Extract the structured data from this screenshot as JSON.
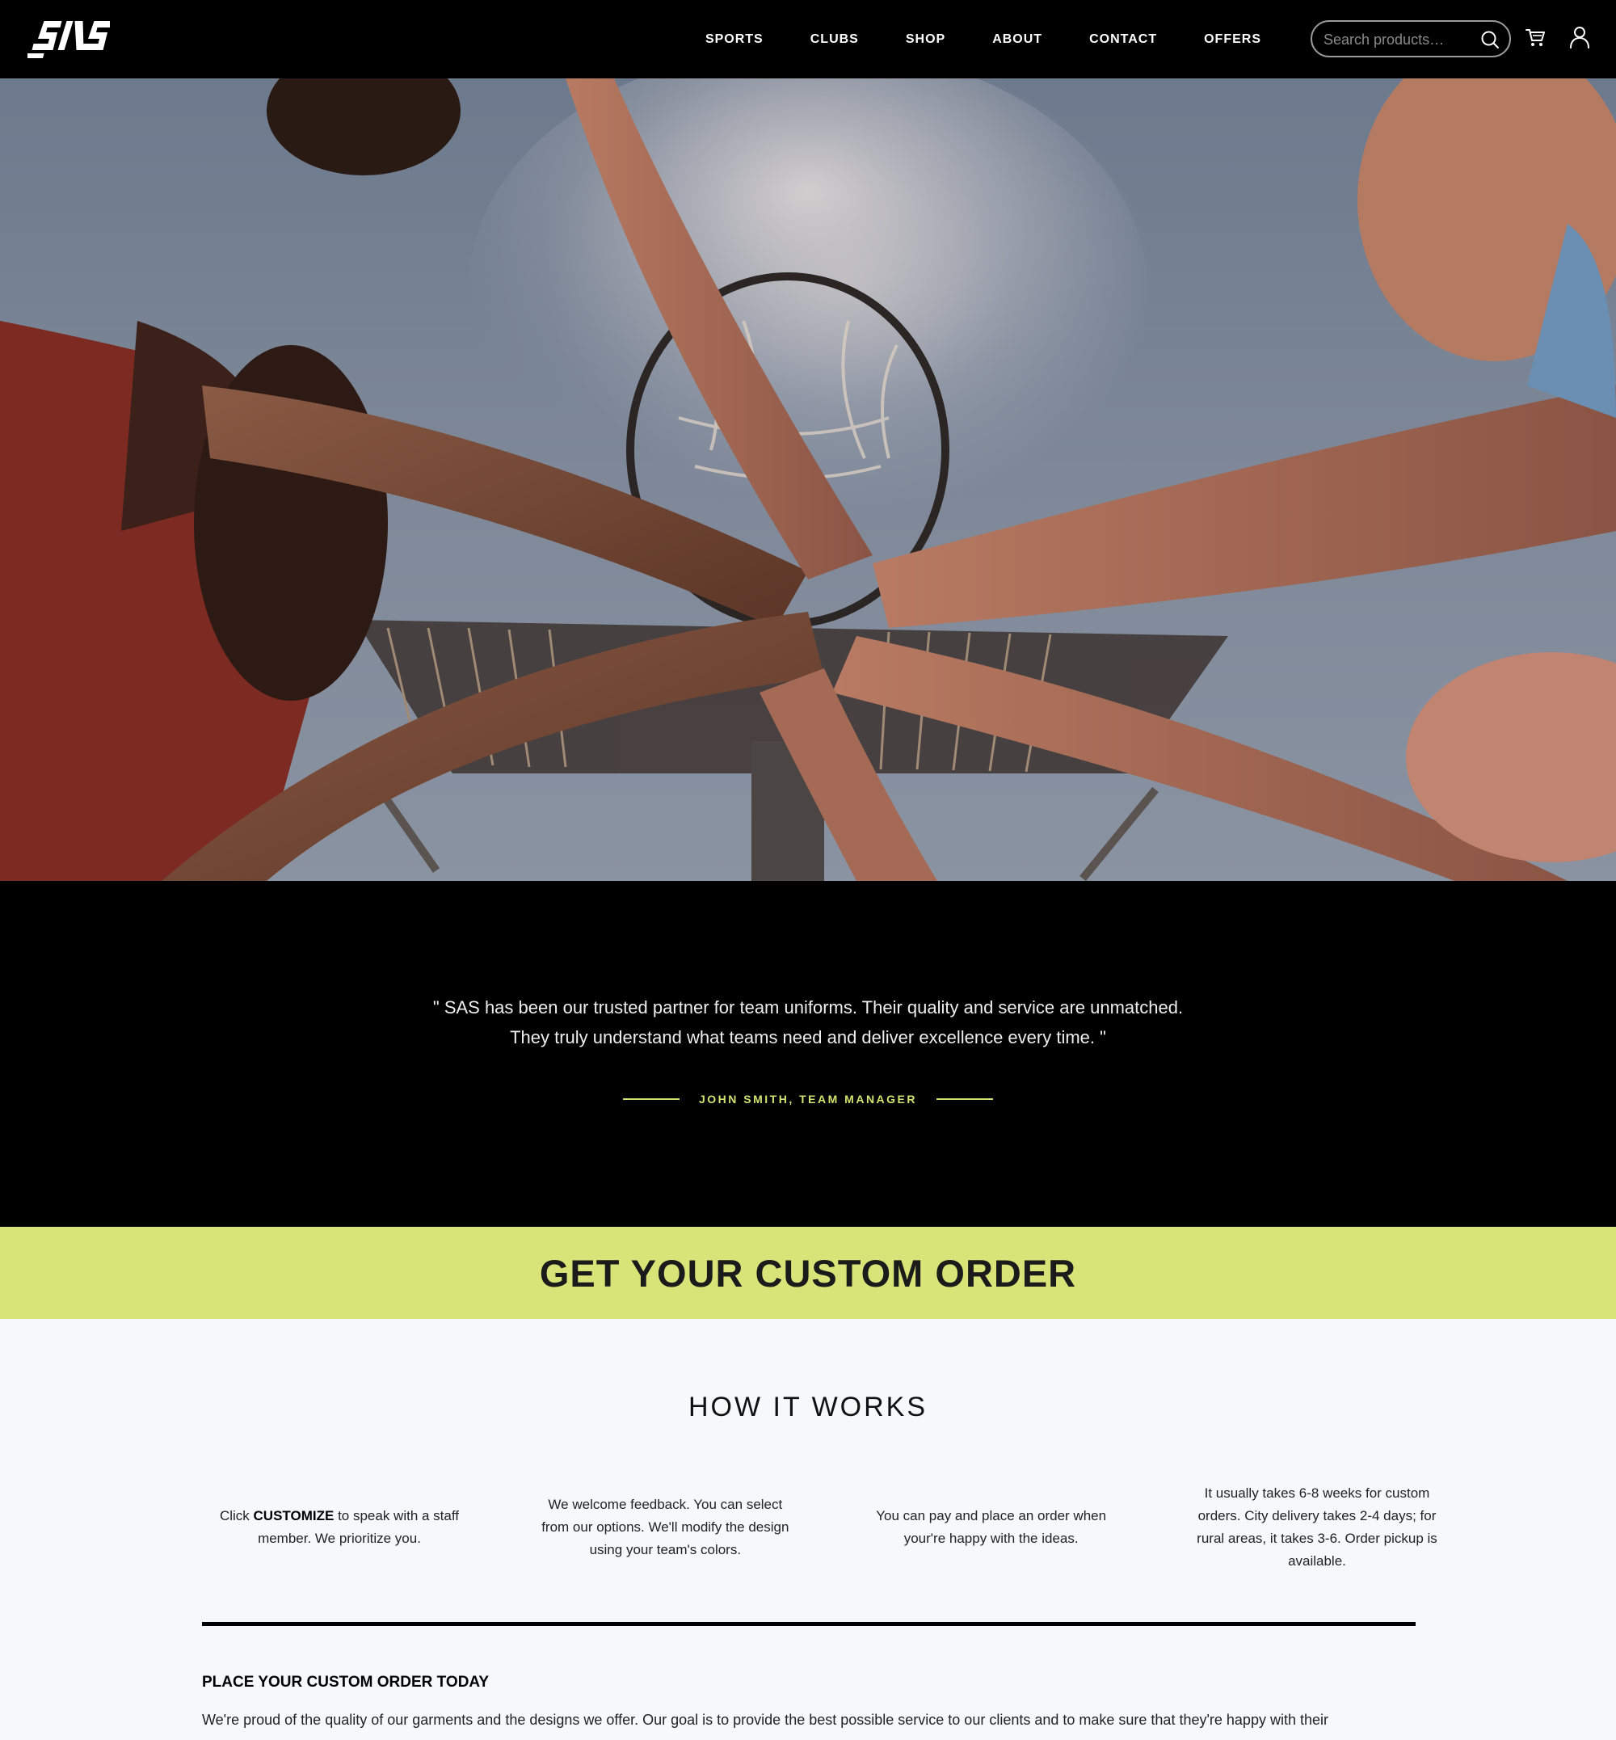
{
  "brand": {
    "logo_text": "SAS"
  },
  "nav": {
    "items": [
      {
        "label": "SPORTS"
      },
      {
        "label": "CLUBS"
      },
      {
        "label": "SHOP"
      },
      {
        "label": "ABOUT"
      },
      {
        "label": "CONTACT"
      },
      {
        "label": "OFFERS"
      }
    ]
  },
  "search": {
    "placeholder": "Search products…",
    "value": ""
  },
  "hero": {
    "icon": "hands-together-basketball-hoop-photo"
  },
  "testimonial": {
    "quote_line1": "\" SAS has been our trusted partner for team uniforms. Their quality and service are unmatched.",
    "quote_line2": "They truly understand what teams need and deliver excellence every time. \"",
    "author": "JOHN SMITH, TEAM MANAGER",
    "accent_color": "#d4e26f"
  },
  "banner": {
    "title": "GET YOUR CUSTOM ORDER",
    "background": "#d9e478"
  },
  "how_it_works": {
    "title": "HOW IT WORKS",
    "steps": [
      {
        "prefix": "Click ",
        "bold": "CUSTOMIZE",
        "suffix": " to speak with a staff member. We prioritize you."
      },
      {
        "text": "We welcome feedback. You can select from our options. We'll modify the design using your team's colors."
      },
      {
        "text": "You can pay and place an order when your're happy with the ideas."
      },
      {
        "text": "It usually takes 6-8 weeks for custom orders. City delivery takes 2-4 days; for rural areas, it takes 3-6. Order pickup is available."
      }
    ]
  },
  "place_order": {
    "title": "PLACE YOUR CUSTOM ORDER TODAY",
    "text": "We're proud of the quality of our garments and the designs we offer. Our goal is to provide the best possible service to our clients and to make sure that they're happy with their"
  }
}
